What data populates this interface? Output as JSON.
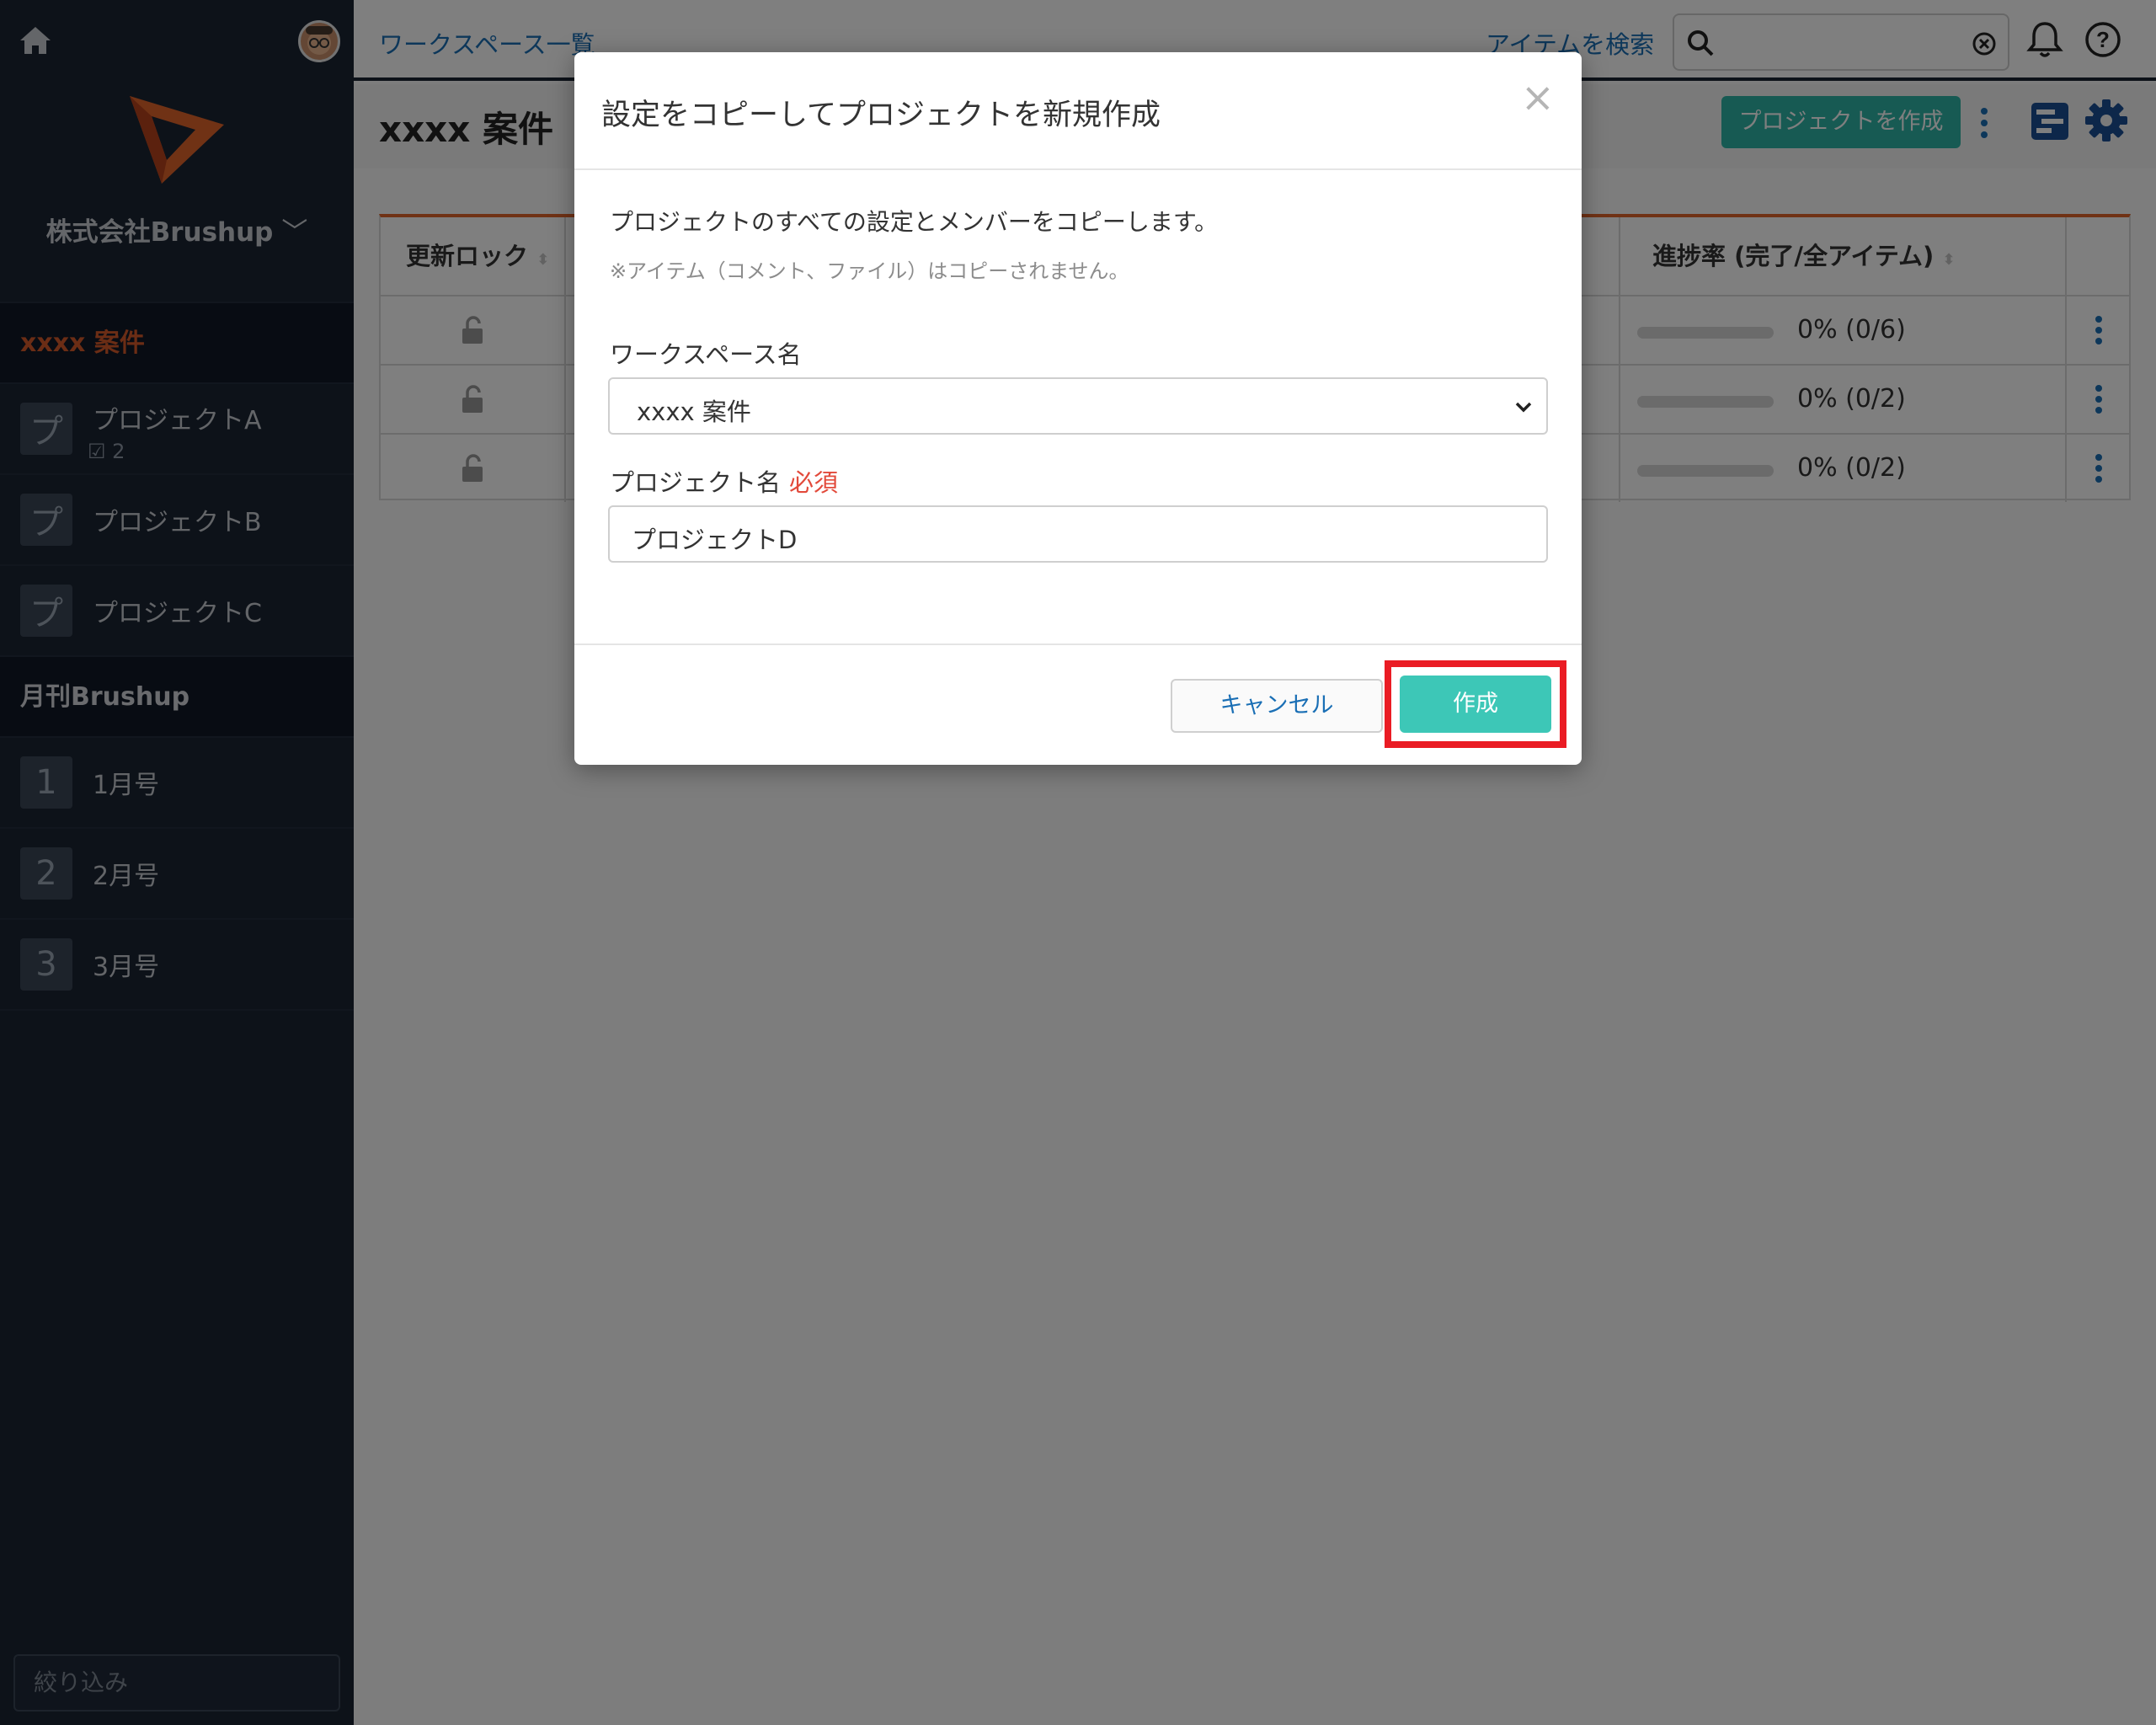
{
  "sidebar": {
    "org_name": "株式会社Brushup",
    "workspaces": [
      {
        "name": "xxxx 案件",
        "active": true,
        "projects": [
          {
            "badge": "プ",
            "label": "プロジェクトA",
            "sub": "2"
          },
          {
            "badge": "プ",
            "label": "プロジェクトB"
          },
          {
            "badge": "プ",
            "label": "プロジェクトC"
          }
        ]
      },
      {
        "name": "月刊Brushup",
        "active": false,
        "projects": [
          {
            "badge": "1",
            "label": "1月号"
          },
          {
            "badge": "2",
            "label": "2月号"
          },
          {
            "badge": "3",
            "label": "3月号"
          }
        ]
      }
    ],
    "filter_placeholder": "絞り込み"
  },
  "topbar": {
    "breadcrumb": "ワークスペース一覧",
    "search_link": "アイテムを検索",
    "search_placeholder": ""
  },
  "page": {
    "title": "xxxx 案件",
    "create_project_label": "プロジェクトを作成"
  },
  "table": {
    "headers": {
      "lock": "更新ロック",
      "progress": "進捗率 (完了/全アイテム)"
    },
    "rows": [
      {
        "progress_text": "0% (0/6)",
        "progress": 0
      },
      {
        "progress_text": "0% (0/2)",
        "progress": 0
      },
      {
        "progress_text": "0% (0/2)",
        "progress": 0
      }
    ]
  },
  "modal": {
    "title": "設定をコピーしてプロジェクトを新規作成",
    "close_glyph": "×",
    "description": "プロジェクトのすべての設定とメンバーをコピーします。",
    "note": "※アイテム（コメント、ファイル）はコピーされません。",
    "workspace_label": "ワークスペース名",
    "workspace_value": "xxxx 案件",
    "project_label": "プロジェクト名",
    "required_label": "必須",
    "project_value": "プロジェクトD",
    "cancel_label": "キャンセル",
    "create_label": "作成"
  },
  "colors": {
    "sidebar_bg": "#1b2433",
    "accent_orange": "#e0642a",
    "teal": "#3dc7b7",
    "link_blue": "#1a6fb5",
    "highlight_red": "#ea1c24"
  }
}
